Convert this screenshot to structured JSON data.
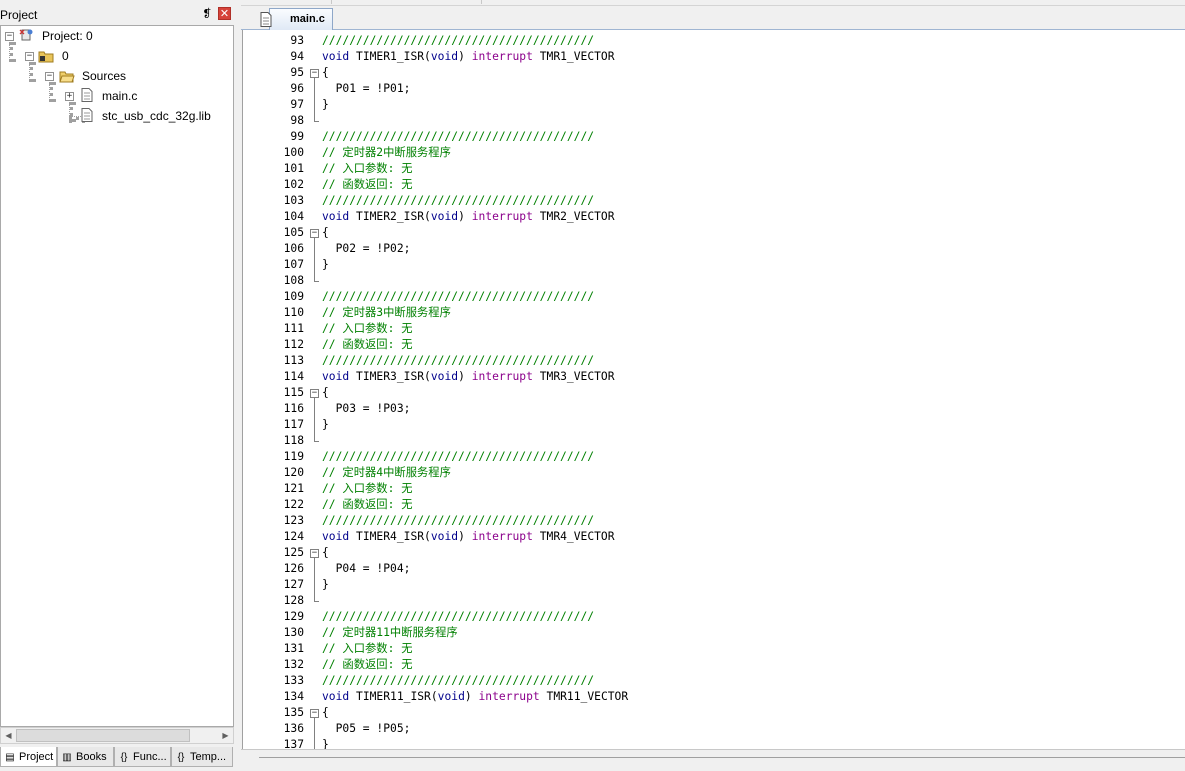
{
  "project_panel": {
    "title": "Project",
    "pin_glyph": "❡",
    "close_glyph": "✕",
    "tree": {
      "root": "Project: 0",
      "target": "0",
      "group": "Sources",
      "files": [
        "main.c",
        "stc_usb_cdc_32g.lib"
      ]
    },
    "tabs": [
      {
        "label": "Project",
        "icon": "project-icon"
      },
      {
        "label": "Books",
        "icon": "books-icon"
      },
      {
        "label": "Func...",
        "icon": "functions-icon"
      },
      {
        "label": "Temp...",
        "icon": "templates-icon"
      }
    ]
  },
  "editor": {
    "active_tab": "main.c",
    "lines": [
      {
        "n": "93",
        "t": "comment",
        "text": "////////////////////////////////////////"
      },
      {
        "n": "94",
        "t": "isr",
        "name": "TIMER1_ISR",
        "vec": "TMR1_VECTOR"
      },
      {
        "n": "95",
        "t": "open",
        "text": "{"
      },
      {
        "n": "96",
        "t": "stmt",
        "text": "  P01 = !P01;"
      },
      {
        "n": "97",
        "t": "close",
        "text": "}"
      },
      {
        "n": "98",
        "t": "blank",
        "text": ""
      },
      {
        "n": "99",
        "t": "comment",
        "text": "////////////////////////////////////////"
      },
      {
        "n": "100",
        "t": "comment",
        "text": "// 定时器2中断服务程序"
      },
      {
        "n": "101",
        "t": "comment",
        "text": "// 入口参数: 无"
      },
      {
        "n": "102",
        "t": "comment",
        "text": "// 函数返回: 无"
      },
      {
        "n": "103",
        "t": "comment",
        "text": "////////////////////////////////////////"
      },
      {
        "n": "104",
        "t": "isr",
        "name": "TIMER2_ISR",
        "vec": "TMR2_VECTOR"
      },
      {
        "n": "105",
        "t": "open",
        "text": "{"
      },
      {
        "n": "106",
        "t": "stmt",
        "text": "  P02 = !P02;"
      },
      {
        "n": "107",
        "t": "close",
        "text": "}"
      },
      {
        "n": "108",
        "t": "blank",
        "text": ""
      },
      {
        "n": "109",
        "t": "comment",
        "text": "////////////////////////////////////////"
      },
      {
        "n": "110",
        "t": "comment",
        "text": "// 定时器3中断服务程序"
      },
      {
        "n": "111",
        "t": "comment",
        "text": "// 入口参数: 无"
      },
      {
        "n": "112",
        "t": "comment",
        "text": "// 函数返回: 无"
      },
      {
        "n": "113",
        "t": "comment",
        "text": "////////////////////////////////////////"
      },
      {
        "n": "114",
        "t": "isr",
        "name": "TIMER3_ISR",
        "vec": "TMR3_VECTOR"
      },
      {
        "n": "115",
        "t": "open",
        "text": "{"
      },
      {
        "n": "116",
        "t": "stmt",
        "text": "  P03 = !P03;"
      },
      {
        "n": "117",
        "t": "close",
        "text": "}"
      },
      {
        "n": "118",
        "t": "blank",
        "text": ""
      },
      {
        "n": "119",
        "t": "comment",
        "text": "////////////////////////////////////////"
      },
      {
        "n": "120",
        "t": "comment",
        "text": "// 定时器4中断服务程序"
      },
      {
        "n": "121",
        "t": "comment",
        "text": "// 入口参数: 无"
      },
      {
        "n": "122",
        "t": "comment",
        "text": "// 函数返回: 无"
      },
      {
        "n": "123",
        "t": "comment",
        "text": "////////////////////////////////////////"
      },
      {
        "n": "124",
        "t": "isr",
        "name": "TIMER4_ISR",
        "vec": "TMR4_VECTOR"
      },
      {
        "n": "125",
        "t": "open",
        "text": "{"
      },
      {
        "n": "126",
        "t": "stmt",
        "text": "  P04 = !P04;"
      },
      {
        "n": "127",
        "t": "close",
        "text": "}"
      },
      {
        "n": "128",
        "t": "blank",
        "text": ""
      },
      {
        "n": "129",
        "t": "comment",
        "text": "////////////////////////////////////////"
      },
      {
        "n": "130",
        "t": "comment",
        "text": "// 定时器11中断服务程序"
      },
      {
        "n": "131",
        "t": "comment",
        "text": "// 入口参数: 无"
      },
      {
        "n": "132",
        "t": "comment",
        "text": "// 函数返回: 无"
      },
      {
        "n": "133",
        "t": "comment",
        "text": "////////////////////////////////////////"
      },
      {
        "n": "134",
        "t": "isr",
        "name": "TIMER11_ISR",
        "vec": "TMR11_VECTOR"
      },
      {
        "n": "135",
        "t": "open",
        "text": "{"
      },
      {
        "n": "136",
        "t": "stmt",
        "text": "  P05 = !P05;"
      },
      {
        "n": "137",
        "t": "close",
        "text": "}"
      }
    ],
    "keywords": {
      "void": "void",
      "interrupt": "interrupt"
    },
    "colors": {
      "comment": "#008000",
      "keyword": "#00008b",
      "interrupt": "#8b008b"
    }
  }
}
